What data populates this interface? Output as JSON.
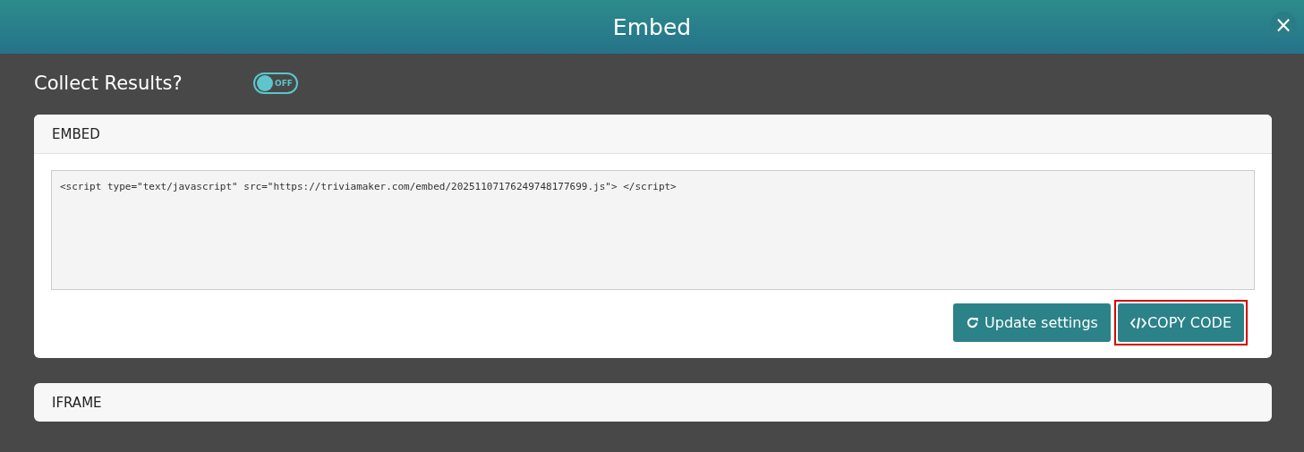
{
  "window": {
    "title": "Embed",
    "close": "×"
  },
  "collect_results": {
    "label": "Collect Results?",
    "toggle": {
      "on": false,
      "text": "OFF"
    }
  },
  "embed_panel": {
    "title": "EMBED",
    "code": "<script type=\"text/javascript\" src=\"https://triviamaker.com/embed/20251107176249748177699.js\"> </script>",
    "buttons": [
      {
        "kind": "refresh",
        "label": "Update settings",
        "highlighted": false
      },
      {
        "kind": "code",
        "label": "COPY CODE",
        "highlighted": true
      }
    ]
  },
  "iframe_panel": {
    "title": "IFRAME"
  }
}
